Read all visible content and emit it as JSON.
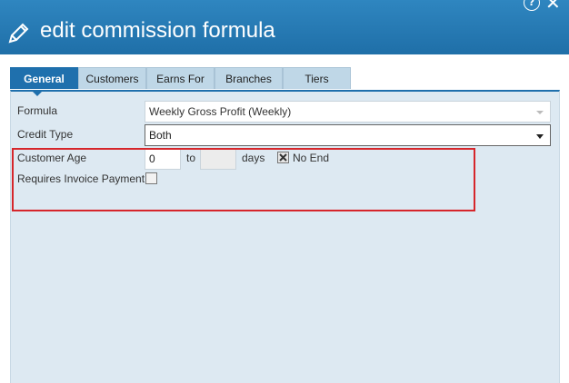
{
  "window": {
    "title": "edit commission formula",
    "help_icon": "?",
    "close_icon": "✕"
  },
  "tabs": [
    {
      "label": "General",
      "active": true
    },
    {
      "label": "Customers",
      "active": false
    },
    {
      "label": "Earns For",
      "active": false
    },
    {
      "label": "Branches",
      "active": false
    },
    {
      "label": "Tiers",
      "active": false
    }
  ],
  "form": {
    "formula_label": "Formula",
    "formula_value": "Weekly Gross Profit (Weekly)",
    "credit_type_label": "Credit Type",
    "credit_type_value": "Both",
    "customer_age_label": "Customer Age",
    "customer_age_from": "0",
    "to_label": "to",
    "customer_age_to": "",
    "days_label": "days",
    "no_end_label": "No End",
    "no_end_checked": true,
    "requires_invoice_label": "Requires Invoice Payment",
    "requires_invoice_checked": false
  },
  "colors": {
    "titlebar": "#1f6fa8",
    "active_tab": "#1f70ad",
    "panel": "#dde9f2",
    "highlight": "#d6262b"
  }
}
